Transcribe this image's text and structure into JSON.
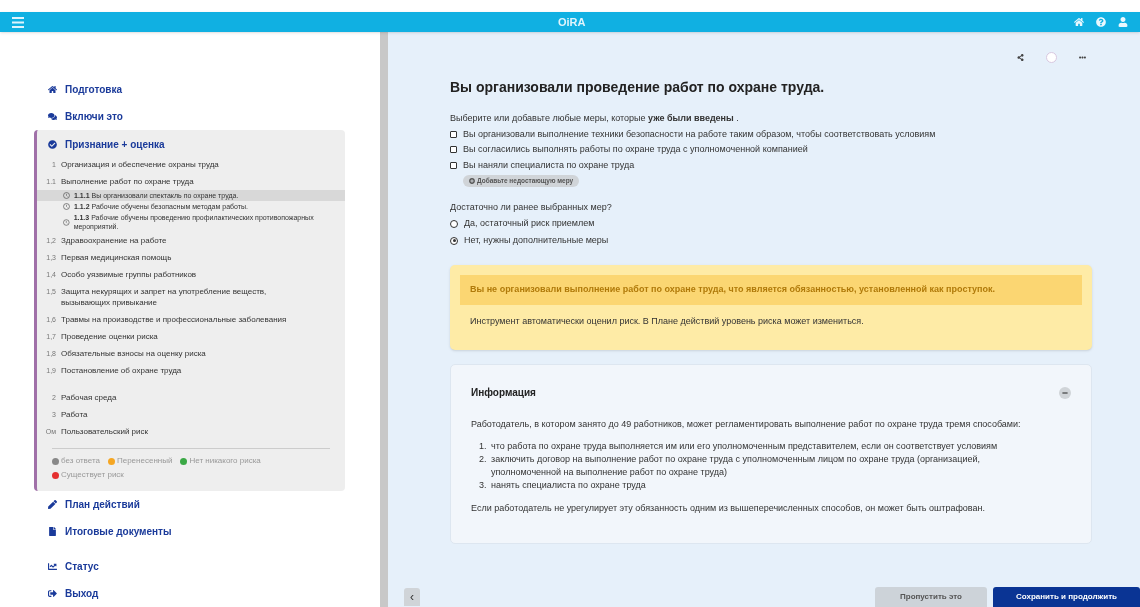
{
  "topbar": {
    "logo": "OiRA"
  },
  "nav_top": [
    {
      "kind": "home",
      "label": "Подготовка"
    },
    {
      "kind": "chat",
      "label": "Включи это"
    }
  ],
  "section": {
    "label": "Признание + оценка",
    "items": [
      {
        "number": "1",
        "label": "Организация и обеспечение охраны труда"
      },
      {
        "number": "1.1",
        "label": "Выполнение работ по охране труда",
        "children": [
          {
            "number": "1.1.1",
            "label": "Вы организовали спектакль по охране труда.",
            "selected": true
          },
          {
            "number": "1.1.2",
            "label": "Рабочие обучены безопасным методам работы.",
            "selected": false
          },
          {
            "number": "1.1.3",
            "label": "Рабочие обучены проведению профилактических противопожарных мероприятий.",
            "selected": false
          }
        ]
      },
      {
        "number": "1,2",
        "label": "Здравоохранение на работе"
      },
      {
        "number": "1,3",
        "label": "Первая медицинская помощь"
      },
      {
        "number": "1,4",
        "label": "Особо уязвимые группы работников"
      },
      {
        "number": "1,5",
        "label": "Защита некурящих и запрет на употребление веществ, вызывающих привыкание"
      },
      {
        "number": "1,6",
        "label": "Травмы на производстве и профессиональные заболевания"
      },
      {
        "number": "1,7",
        "label": "Проведение оценки риска"
      },
      {
        "number": "1,8",
        "label": "Обязательные взносы на оценку риска"
      },
      {
        "number": "1,9",
        "label": "Постановление об охране труда",
        "gap_after": true
      },
      {
        "number": "2",
        "label": "Рабочая среда"
      },
      {
        "number": "3",
        "label": "Работа"
      },
      {
        "number": "Ом",
        "label": "Пользовательский риск"
      }
    ],
    "legend": [
      {
        "label": "без ответа",
        "color": "#888888"
      },
      {
        "label": "Перенесенный",
        "color": "#f5a623"
      },
      {
        "label": "Нет никакого риска",
        "color": "#3aa845"
      },
      {
        "label": "Существует риск",
        "color": "#e53030"
      }
    ]
  },
  "nav_bottom": [
    {
      "kind": "pencil",
      "label": "План действий"
    },
    {
      "kind": "file",
      "label": "Итоговые документы"
    },
    {
      "kind": "status",
      "label": "Статус"
    },
    {
      "kind": "logout",
      "label": "Выход"
    }
  ],
  "main": {
    "title": "Вы организовали проведение работ по охране труда.",
    "measures_intro": "Выберите или добавьте любые меры, которые **уже были введены** .",
    "measures": [
      {
        "label": "Вы организовали выполнение техники безопасности на работе таким образом, чтобы соответствовать условиям",
        "checked": false
      },
      {
        "label": "Вы согласились выполнять работы по охране труда с уполномоченной компанией",
        "checked": false
      },
      {
        "label": "Вы наняли специалиста по охране труда",
        "checked": false
      }
    ],
    "add_measure": "Добавьте недостающую меру",
    "question": "Достаточно ли ранее выбранных мер?",
    "answers": [
      {
        "label": "Да, остаточный риск приемлем",
        "selected": false
      },
      {
        "label": "Нет, нужны дополнительные меры",
        "selected": true
      }
    ],
    "warning": {
      "title": "Вы не организовали выполнение работ по охране труда, что является обязанностью, установленной как проступок.",
      "text": "Инструмент автоматически оценил риск. В Плане действий уровень риска может измениться."
    },
    "info": {
      "title": "Информация",
      "expanded": true,
      "intro": "Работодатель, в котором занято до 49 работников, может регламентировать выполнение работ по охране труда тремя способами:",
      "list": [
        {
          "number": "1.",
          "text": "что работа по охране труда выполняется им или его уполномоченным представителем, если он соответствует условиям"
        },
        {
          "number": "2.",
          "text": "заключить договор на выполнение работ по охране труда с уполномоченным лицом по охране труда (организацией, уполномоченной на выполнение работ по охране труда)"
        },
        {
          "number": "3.",
          "text": "нанять специалиста по охране труда"
        }
      ],
      "outro": "Если работодатель не урегулирует эту обязанность одним из вышеперечисленных способов, он может быть оштрафован."
    }
  },
  "footer": {
    "back": "‹",
    "skip": "Пропустить это",
    "save": "Сохранить и продолжить"
  }
}
